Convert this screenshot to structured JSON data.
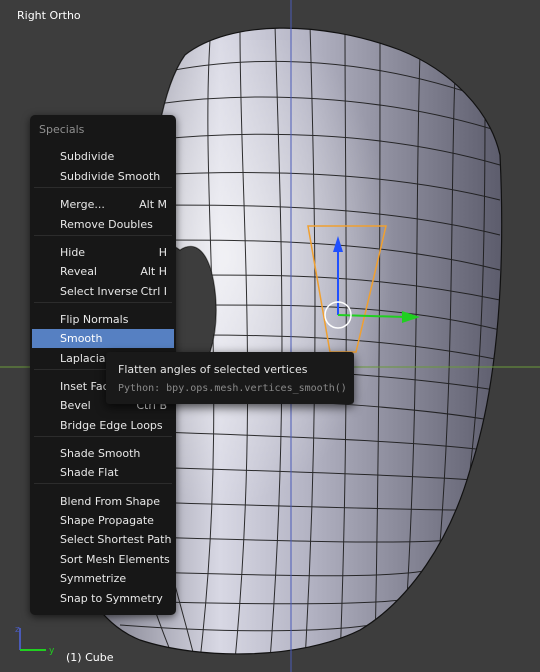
{
  "viewport": {
    "view_name": "Right Ortho",
    "object_label": "(1) Cube",
    "axis_labels": {
      "y": "y",
      "z": "z"
    }
  },
  "menu": {
    "title": "Specials",
    "highlight_color": "#5680c2",
    "groups": [
      [
        {
          "label": "Subdivide",
          "shortcut": ""
        },
        {
          "label": "Subdivide Smooth",
          "shortcut": ""
        }
      ],
      [
        {
          "label": "Merge...",
          "shortcut": "Alt M"
        },
        {
          "label": "Remove Doubles",
          "shortcut": ""
        }
      ],
      [
        {
          "label": "Hide",
          "shortcut": "H"
        },
        {
          "label": "Reveal",
          "shortcut": "Alt H"
        },
        {
          "label": "Select Inverse",
          "shortcut": "Ctrl I"
        }
      ],
      [
        {
          "label": "Flip Normals",
          "shortcut": ""
        },
        {
          "label": "Smooth",
          "shortcut": "",
          "highlighted": true
        },
        {
          "label": "Laplacian Smooth",
          "shortcut": ""
        }
      ],
      [
        {
          "label": "Inset Faces",
          "shortcut": ""
        },
        {
          "label": "Bevel",
          "shortcut": "Ctrl B"
        },
        {
          "label": "Bridge Edge Loops",
          "shortcut": ""
        }
      ],
      [
        {
          "label": "Shade Smooth",
          "shortcut": ""
        },
        {
          "label": "Shade Flat",
          "shortcut": ""
        }
      ],
      [
        {
          "label": "Blend From Shape",
          "shortcut": ""
        },
        {
          "label": "Shape Propagate",
          "shortcut": ""
        },
        {
          "label": "Select Shortest Path",
          "shortcut": ""
        },
        {
          "label": "Sort Mesh Elements",
          "shortcut": ""
        },
        {
          "label": "Symmetrize",
          "shortcut": ""
        },
        {
          "label": "Snap to Symmetry",
          "shortcut": ""
        }
      ]
    ]
  },
  "tooltip": {
    "description": "Flatten angles of selected vertices",
    "python": "Python: bpy.ops.mesh.vertices_smooth()"
  },
  "colors": {
    "background": "#3d3d3d",
    "mesh_light": "#eaeaf2",
    "mesh_dark": "#50505f",
    "x_axis": "#6a9a3a",
    "z_axis": "#4a5ab8",
    "selection": "#f0a030",
    "gizmo_z": "#2050ff",
    "gizmo_y": "#20d020"
  }
}
